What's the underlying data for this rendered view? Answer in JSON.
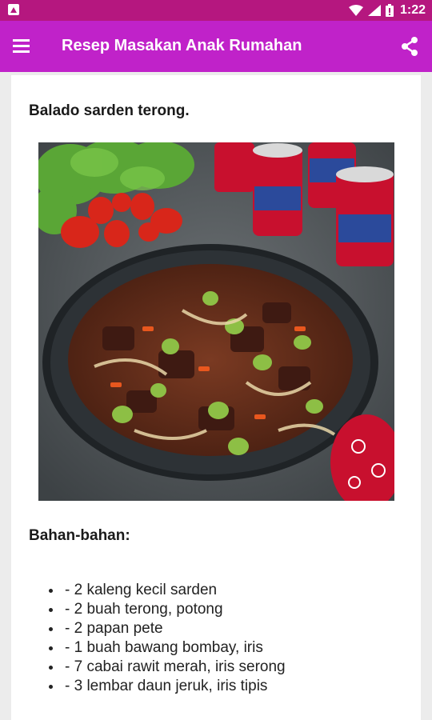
{
  "status_bar": {
    "time": "1:22"
  },
  "app_bar": {
    "title": "Resep Masakan Anak Rumahan"
  },
  "recipe": {
    "title": "Balado sarden terong.",
    "ingredients_heading": "Bahan-bahan:",
    "ingredients": [
      "- 2 kaleng kecil sarden",
      "- 2 buah terong, potong",
      "- 2 papan pete",
      "- 1 buah bawang bombay, iris",
      "- 7 cabai rawit merah, iris serong",
      "- 3 lembar daun jeruk, iris tipis"
    ]
  },
  "colors": {
    "status_bar": "#b5177f",
    "app_bar": "#c022c9"
  }
}
